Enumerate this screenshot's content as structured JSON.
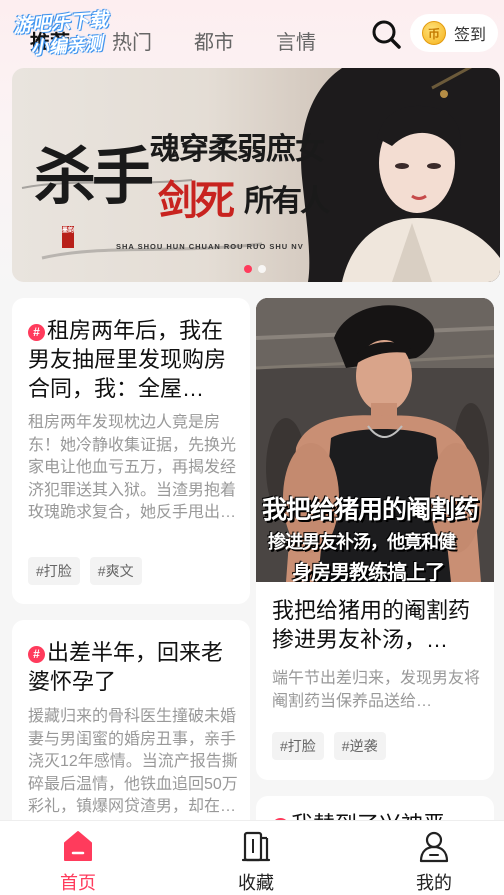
{
  "watermark": {
    "line1": "游吧乐下载",
    "line2": "小编亲测"
  },
  "header": {
    "tabs": [
      {
        "label": "推荐",
        "active": true
      },
      {
        "label": "热门",
        "active": false
      },
      {
        "label": "都市",
        "active": false
      },
      {
        "label": "言情",
        "active": false
      }
    ],
    "checkin_label": "签到",
    "coin_symbol": "币"
  },
  "banner": {
    "title_part1": "杀手",
    "title_part2": "魂穿柔弱庶女",
    "title_part3": "剑死",
    "title_part4": "所有人",
    "seal_text": "墨韵",
    "pinyin": "SHA SHOU   HUN CHUAN ROU RUO SHU NV",
    "page_count": 2,
    "active_index": 0
  },
  "cards": [
    {
      "title": "租房两年后，我在男友抽屉里发现购房合同，我：全屋…",
      "description": "租房两年发现枕边人竟是房东！她冷静收集证据，先换光家电让他血亏五万，再揭发经济犯罪送其入狱。当渣男抱着玫瑰跪求复合，她反手甩出转账…",
      "tags": [
        "#打脸",
        "#爽文"
      ]
    },
    {
      "title": "我把给猪用的阉割药掺进男友补汤，…",
      "description": "端午节出差归来，发现男友将阉割药当保养品送给…",
      "tags": [
        "#打脸",
        "#逆袭"
      ],
      "cover_text": [
        "我把给猪用的阉割药",
        "掺进男友补汤，他竟和健",
        "身房男教练搞上了"
      ]
    },
    {
      "title": "出差半年，回来老婆怀孕了",
      "description": "援藏归来的骨科医生撞破未婚妻与男闺蜜的婚房丑事，亲手浇灭12年感情。当流产报告撕碎最后温情，他铁血追回50万彩礼，镇爆网贷渣男，却在…"
    },
    {
      "title": "我替到了兴神恶…"
    }
  ],
  "navbar": [
    {
      "label": "首页",
      "icon": "home-icon",
      "active": true
    },
    {
      "label": "收藏",
      "icon": "bookshelf-icon",
      "active": false
    },
    {
      "label": "我的",
      "icon": "profile-icon",
      "active": false
    }
  ],
  "colors": {
    "accent": "#ff3b5c",
    "background": "#f6f6f6"
  }
}
